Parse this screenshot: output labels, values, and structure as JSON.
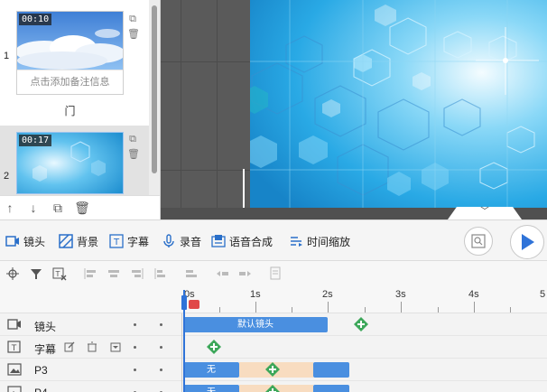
{
  "slides": [
    {
      "number": "1",
      "time": "00:10",
      "note": "点击添加备注信息",
      "title": "门"
    },
    {
      "number": "2",
      "time": "00:17"
    }
  ],
  "toolbar": {
    "camera": "镜头",
    "background": "背景",
    "subtitle": "字幕",
    "record": "录音",
    "tts": "语音合成",
    "time_scale": "时间缩放"
  },
  "ruler": {
    "labels": [
      "0s",
      "1s",
      "2s",
      "3s",
      "4s",
      "5"
    ]
  },
  "tracks": [
    {
      "name": "镜头",
      "clip_label": "默认镜头"
    },
    {
      "name": "字幕"
    },
    {
      "name": "P3",
      "clip_label": "无"
    },
    {
      "name": "P4",
      "clip_label": "无"
    }
  ],
  "colors": {
    "accent": "#2f73d8",
    "clip_blue": "#4a8fe0",
    "add_green": "#3da75a",
    "marker_red": "#e04848"
  }
}
